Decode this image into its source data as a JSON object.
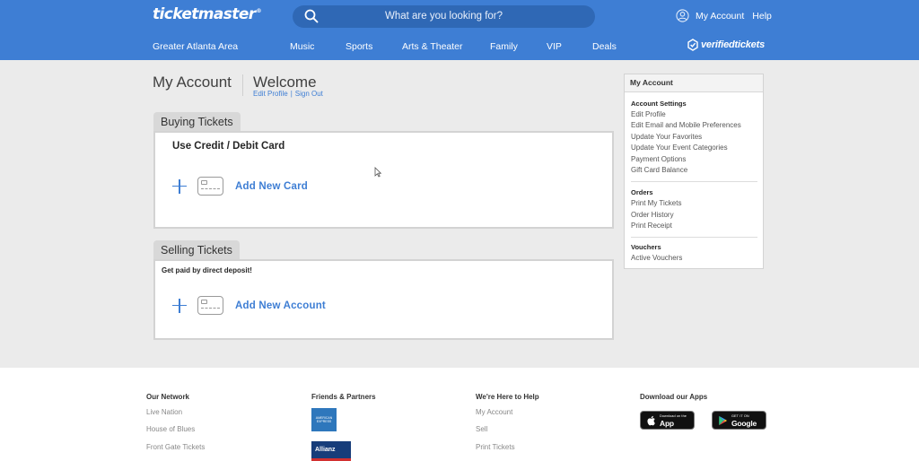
{
  "header": {
    "logo": "ticketmaster",
    "logo_mark": "®",
    "search_placeholder": "What are you looking for?",
    "search_icon": "search-icon",
    "account_icon": "user-circle-icon",
    "account_label": "My Account",
    "help_label": "Help",
    "region": "Greater Atlanta Area",
    "nav": [
      "Music",
      "Sports",
      "Arts & Theater",
      "Family",
      "VIP",
      "Deals"
    ],
    "verified_label": "verifiedtickets",
    "verified_icon": "verified-ticket-icon",
    "brand_color": "#3e7ed4"
  },
  "page": {
    "title": "My Account",
    "welcome": "Welcome",
    "edit_profile": "Edit Profile",
    "separator": "|",
    "sign_out": "Sign Out"
  },
  "buying": {
    "tab_label": "Buying Tickets",
    "heading": "Use Credit / Debit Card",
    "add_label": "Add New Card"
  },
  "selling": {
    "tab_label": "Selling Tickets",
    "heading": "Get paid by direct deposit!",
    "add_label": "Add New Account"
  },
  "sidebar": {
    "title": "My Account",
    "sections": [
      {
        "heading": "Account Settings",
        "links": [
          "Edit Profile",
          "Edit Email and Mobile Preferences",
          "Update Your Favorites",
          "Update Your Event Categories",
          "Payment Options",
          "Gift Card Balance"
        ]
      },
      {
        "heading": "Orders",
        "links": [
          "Print My Tickets",
          "Order History",
          "Print Receipt"
        ]
      },
      {
        "heading": "Vouchers",
        "links": [
          "Active Vouchers"
        ]
      }
    ]
  },
  "footer": {
    "network": {
      "heading": "Our Network",
      "links": [
        "Live Nation",
        "House of Blues",
        "Front Gate Tickets"
      ]
    },
    "partners": {
      "heading": "Friends & Partners",
      "amex_text": "AMERICAN EXPRESS",
      "allianz_text": "Allianz"
    },
    "help": {
      "heading": "We're Here to Help",
      "links": [
        "My Account",
        "Sell",
        "Print Tickets"
      ]
    },
    "apps": {
      "heading": "Download our Apps",
      "app_store_small": "Download on the",
      "app_store_big": "App Store",
      "google_small": "GET IT ON",
      "google_big": "Google play"
    }
  }
}
